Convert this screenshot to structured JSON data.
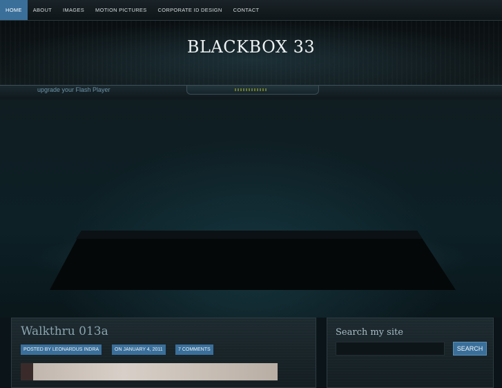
{
  "nav": {
    "items": [
      {
        "label": "HOME",
        "active": true
      },
      {
        "label": "ABOUT"
      },
      {
        "label": "IMAGES"
      },
      {
        "label": "MOTION PICTURES"
      },
      {
        "label": "CORPORATE ID DESIGN"
      },
      {
        "label": "CONTACT"
      }
    ]
  },
  "header": {
    "site_title": "BLACKBOX 33",
    "flash_notice": "upgrade your Flash Player"
  },
  "post": {
    "title": "Walkthru 013a",
    "author": "POSTED BY LEONARDUS INDRA",
    "date": "ON JANUARY 4, 2011",
    "comments": "7 COMMENTS"
  },
  "sidebar": {
    "search_heading": "Search my site",
    "search_value": "",
    "search_button": "SEARCH"
  },
  "colors": {
    "accent": "#3a6f9a",
    "background": "#0b1418",
    "title_text": "#8aa4b0"
  }
}
